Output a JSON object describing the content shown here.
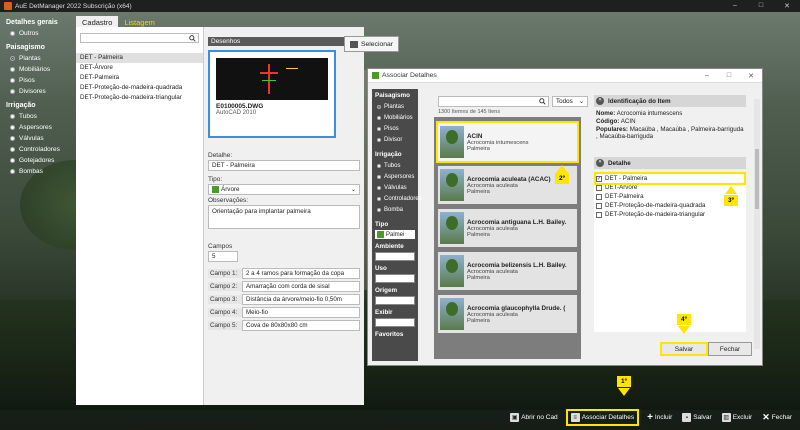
{
  "window": {
    "title": "AuE DetManager 2022 Subscrição (x64)"
  },
  "sidebar": {
    "groups": [
      {
        "title": "Detalhes gerais",
        "items": [
          "Outros"
        ]
      },
      {
        "title": "Paisagismo",
        "items": [
          "Plantas",
          "Mobiliários",
          "Pisos",
          "Divisores"
        ]
      },
      {
        "title": "Irrigação",
        "items": [
          "Tubos",
          "Aspersores",
          "Válvulas",
          "Controladores",
          "Gotejadores",
          "Bombas"
        ]
      }
    ]
  },
  "tabs": [
    "Cadastro",
    "Listagem"
  ],
  "list": [
    "DET - Palmeira",
    "DET-Árvore",
    "DET-Palmeira",
    "DET-Proteção-de-madeira-quadrada",
    "DET-Proteção-de-madeira-triangular"
  ],
  "details": {
    "drawings_label": "Desenhos",
    "select_button": "Selecionar",
    "file_name": "E0100005.DWG",
    "file_sub": "AutoCAD 2010",
    "detail_label": "Detalhe:",
    "detail_value": "DET - Palmeira",
    "type_label": "Tipo:",
    "type_value": "Árvore",
    "notes_label": "Observações:",
    "notes_value": "Orientação para implantar palmeira",
    "fields_label": "Campos",
    "fields_count": "5",
    "fields": [
      {
        "label": "Campo 1:",
        "value": "2 a 4 ramos para formação da copa"
      },
      {
        "label": "Campo 2:",
        "value": "Amarração com corda de sisal"
      },
      {
        "label": "Campo 3:",
        "value": "Distância da árvore/meio-fio 0,50m"
      },
      {
        "label": "Campo 4:",
        "value": "Meio-fio"
      },
      {
        "label": "Campo 5:",
        "value": "Cova de 80x80x80 cm"
      }
    ]
  },
  "dialog": {
    "title": "Associar Detalhes",
    "side": {
      "paisagismo": "Paisagismo",
      "paisagismo_items": [
        "Plantas",
        "Mobiliários",
        "Pisos",
        "Divisor"
      ],
      "irrigacao": "Irrigação",
      "irrigacao_items": [
        "Tubos",
        "Aspersores",
        "Válvulas",
        "Controladores",
        "Bomba"
      ],
      "tipo": "Tipo",
      "tipo_value": "Palmei",
      "filters": [
        "Ambiente",
        "Uso",
        "Origem",
        "Exibir",
        "Favoritos"
      ]
    },
    "filter_value": "Todos",
    "count": "1300 Itemns de 145 Itens",
    "items": [
      {
        "name": "ACIN",
        "sci": "Acrocomia intumescens",
        "type": "Palmeira"
      },
      {
        "name": "Acrocomia aculeata (ACAC)",
        "sci": "Acrocomia aculeata",
        "type": "Palmeira"
      },
      {
        "name": "Acrocomia antiguana L.H. Bailey.",
        "sci": "Acrocomia aculeata",
        "type": "Palmeira"
      },
      {
        "name": "Acrocomia belizensis L.H. Bailey.",
        "sci": "Acrocomia aculeata",
        "type": "Palmeira"
      },
      {
        "name": "Acrocomia glaucophylla Drude. (",
        "sci": "Acrocomia aculeata",
        "type": "Palmeira"
      }
    ],
    "id_section": "Identificação do Item",
    "info_name_label": "Nome:",
    "info_name": "Acrocomia intumescens",
    "info_code_label": "Código:",
    "info_code": "ACIN",
    "info_pop_label": "Populares:",
    "info_pop": "Macaúba , Macaúba , Palmeira-barriguda , Macaúba-barriguda",
    "detail_section": "Detalhe",
    "checks": [
      {
        "label": "DET - Palmeira",
        "checked": true
      },
      {
        "label": "DET-Árvore",
        "checked": false
      },
      {
        "label": "DET-Palmeira",
        "checked": false
      },
      {
        "label": "DET-Proteção-de-madeira-quadrada",
        "checked": false
      },
      {
        "label": "DET-Proteção-de-madeira-triangular",
        "checked": false
      }
    ],
    "save": "Salvar",
    "close": "Fechar"
  },
  "steps": [
    "1º",
    "2º",
    "3º",
    "4º"
  ],
  "toolbar": [
    "Abrir no Cad",
    "Associar Detalhes",
    "Incluir",
    "Salvar",
    "Excluir",
    "Fechar"
  ],
  "colors": {
    "highlight": "#ffe600",
    "accent": "#3b8ee0"
  }
}
